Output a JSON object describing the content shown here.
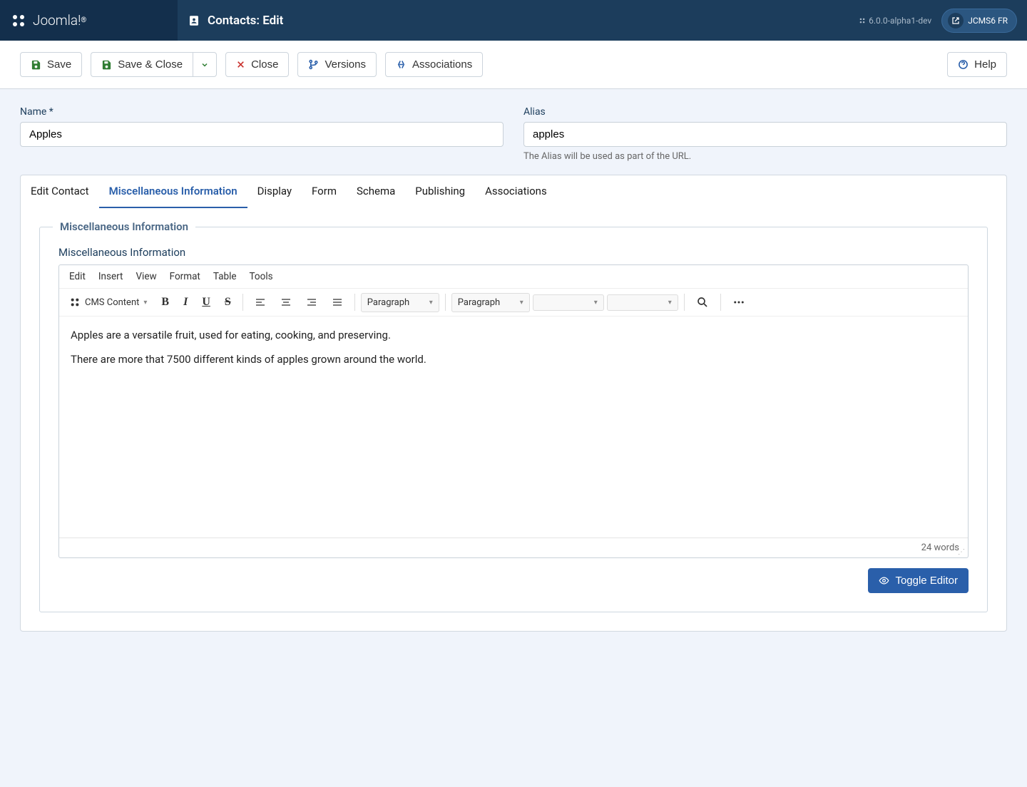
{
  "header": {
    "brand": "Joomla!",
    "page_title": "Contacts: Edit",
    "version": "6.0.0-alpha1-dev",
    "user_label": "JCMS6 FR"
  },
  "toolbar": {
    "save": "Save",
    "save_close": "Save & Close",
    "close": "Close",
    "versions": "Versions",
    "associations": "Associations",
    "help": "Help"
  },
  "form": {
    "name_label": "Name *",
    "name_value": "Apples",
    "alias_label": "Alias",
    "alias_value": "apples",
    "alias_hint": "The Alias will be used as part of the URL."
  },
  "tabs": {
    "edit_contact": "Edit Contact",
    "misc_info": "Miscellaneous Information",
    "display": "Display",
    "form": "Form",
    "schema": "Schema",
    "publishing": "Publishing",
    "associations": "Associations"
  },
  "misc": {
    "legend": "Miscellaneous Information",
    "label": "Miscellaneous Information",
    "editor_menu": {
      "edit": "Edit",
      "insert": "Insert",
      "view": "View",
      "format": "Format",
      "table": "Table",
      "tools": "Tools"
    },
    "cms_content": "CMS Content",
    "format_select1": "Paragraph",
    "format_select2": "Paragraph",
    "content_p1": "Apples are a versatile fruit, used for eating, cooking, and preserving.",
    "content_p2": "There are more that 7500 different kinds of apples grown around the world.",
    "word_count": "24 words",
    "toggle_editor": "Toggle Editor"
  }
}
